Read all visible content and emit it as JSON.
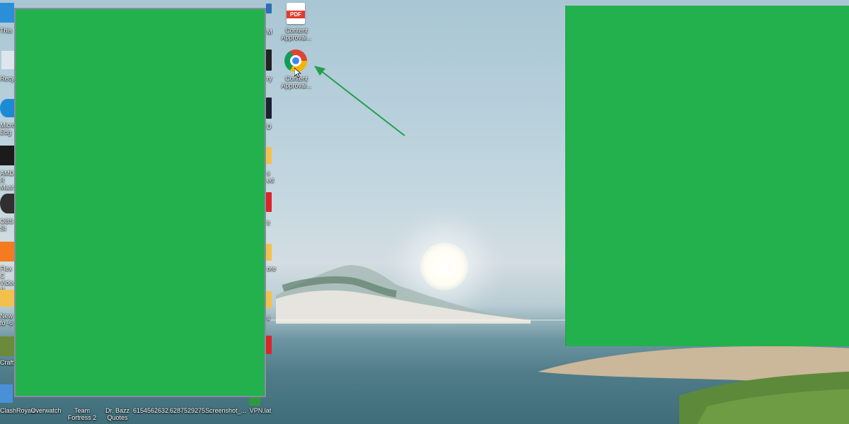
{
  "desktop": {
    "icons_right_column": [
      {
        "label": "Content Approval...",
        "icon": "pdf-icon"
      },
      {
        "label": "Content Approval...",
        "icon": "chrome-icon"
      }
    ],
    "left_column_partial_labels": [
      "This",
      "Recycle",
      "Micro Edg",
      "AMD R Mast",
      "OBS St",
      "Flex C Video N",
      "New fo -6",
      "Craftu"
    ],
    "bottom_row_labels": [
      "ClashRoyale",
      "Overwatch",
      "Team Fortress 2",
      "Dr. Bazz Quotes",
      "6154562632...",
      "6287529275...",
      "Screenshot_...",
      "VPN.lat"
    ],
    "partial_right_labels": [
      "M",
      "ry",
      "D",
      "s ed",
      "it",
      "ore",
      "s"
    ]
  },
  "annotation": {
    "arrow_color": "#22a04b",
    "arrow_target": "chrome-icon"
  },
  "redactions": {
    "color": "#22b14c"
  }
}
